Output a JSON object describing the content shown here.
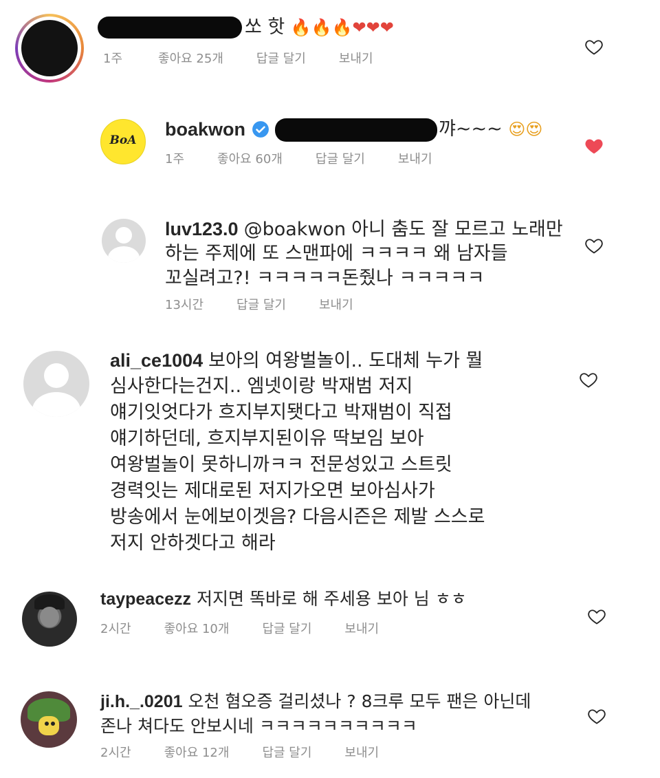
{
  "comments": [
    {
      "text": "쏘 핫",
      "emojis": "🔥🔥🔥❤❤❤",
      "time": "1주",
      "likes": "좋아요 25개",
      "reply": "답글 달기",
      "send": "보내기",
      "liked": false
    },
    {
      "username": "boakwon",
      "verified": true,
      "avatar_text": "BoA",
      "text": "꺄~~~",
      "emojis": "😍😍",
      "time": "1주",
      "likes": "좋아요 60개",
      "reply": "답글 달기",
      "send": "보내기",
      "liked": true
    },
    {
      "username": "luv123.0",
      "mention": "@boakwon",
      "lines": [
        "아니 춤도 잘 모르고 노래만",
        "하는 주제에 또 스맨파에 ㅋㅋㅋㅋ 왜 남자들",
        "꼬실려고?! ㅋㅋㅋㅋㅋ돈줬나 ㅋㅋㅋㅋㅋ"
      ],
      "time": "13시간",
      "reply": "답글 달기",
      "send": "보내기",
      "liked": false
    },
    {
      "username": "ali_ce1004",
      "lines": [
        "보아의 여왕벌놀이.. 도대체 누가 뭘",
        "심사한다는건지.. 엠넷이랑 박재범 저지",
        "얘기잇엇다가 흐지부지됏다고 박재범이 직접",
        "얘기하던데, 흐지부지된이유 딱보임 보아",
        "여왕벌놀이 못하니까ㅋㅋ 전문성있고 스트릿",
        "경력잇는 제대로된 저지가오면 보아심사가",
        "방송에서 눈에보이겟음? 다음시즌은 제발 스스로",
        "저지 안하겟다고 해라"
      ],
      "liked": false
    },
    {
      "username": "taypeacezz",
      "lines": [
        "저지면 똑바로 해 주세용 보아 님 ㅎㅎ"
      ],
      "time": "2시간",
      "likes": "좋아요 10개",
      "reply": "답글 달기",
      "send": "보내기",
      "liked": false
    },
    {
      "username": "ji.h._.0201",
      "lines": [
        "오천 혐오증 걸리셨나 ? 8크루 모두 팬은 아닌데",
        "존나 쳐다도 안보시네 ㅋㅋㅋㅋㅋㅋㅋㅋㅋㅋ"
      ],
      "time": "2시간",
      "likes": "좋아요 12개",
      "reply": "답글 달기",
      "send": "보내기",
      "liked": false
    }
  ],
  "colors": {
    "text": "#262626",
    "meta": "#8e8e8e",
    "liked": "#ed4956",
    "verified": "#3897f0",
    "boa_yellow": "#ffe62e"
  },
  "icons": {
    "heart": "heart-icon",
    "verified": "verified-badge-icon"
  }
}
